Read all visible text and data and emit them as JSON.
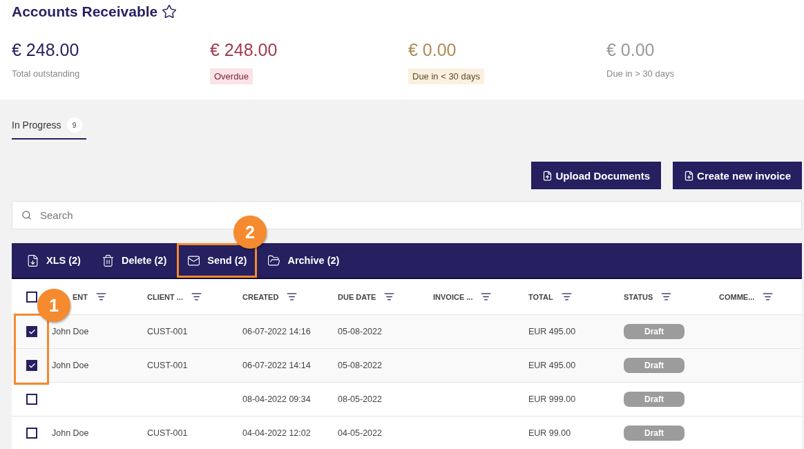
{
  "page": {
    "title": "Accounts Receivable",
    "favorite": false
  },
  "summary": [
    {
      "kind": "total",
      "amount": "€ 248.00",
      "label": "Total outstanding"
    },
    {
      "kind": "overdue",
      "amount": "€ 248.00",
      "label": "Overdue"
    },
    {
      "kind": "soon",
      "amount": "€ 0.00",
      "label": "Due in < 30 days"
    },
    {
      "kind": "later",
      "amount": "€ 0.00",
      "label": "Due in > 30 days"
    }
  ],
  "tabs": [
    {
      "label": "In Progress",
      "count": "9",
      "selected": true
    }
  ],
  "actions": [
    {
      "kind": "upload",
      "label": "Upload Documents"
    },
    {
      "kind": "create",
      "label": "Create new invoice"
    }
  ],
  "search": {
    "placeholder": "Search"
  },
  "toolbar": [
    {
      "kind": "xls",
      "label": "XLS (2)",
      "highlighted": false
    },
    {
      "kind": "delete",
      "label": "Delete (2)",
      "highlighted": false
    },
    {
      "kind": "send",
      "label": "Send (2)",
      "highlighted": true
    },
    {
      "kind": "archive",
      "label": "Archive (2)",
      "highlighted": false
    }
  ],
  "table": {
    "all_checked": false,
    "columns": [
      "ENT",
      "CLIENT ...",
      "CREATED",
      "DUE DATE",
      "INVOICE ...",
      "TOTAL",
      "STATUS",
      "COMME..."
    ],
    "rows": [
      {
        "checked": true,
        "cells": [
          "John Doe",
          "CUST-001",
          "06-07-2022 14:16",
          "05-08-2022",
          "",
          "EUR 495.00"
        ],
        "status": "Draft"
      },
      {
        "checked": true,
        "cells": [
          "John Doe",
          "CUST-001",
          "06-07-2022 14:14",
          "05-08-2022",
          "",
          "EUR 495.00"
        ],
        "status": "Draft"
      },
      {
        "checked": false,
        "cells": [
          "",
          "",
          "08-04-2022 09:34",
          "08-05-2022",
          "",
          "EUR 999.00"
        ],
        "status": "Draft"
      },
      {
        "checked": false,
        "cells": [
          "John Doe",
          "CUST-001",
          "04-04-2022 12:02",
          "04-05-2022",
          "",
          "EUR 99.00"
        ],
        "status": "Draft"
      }
    ]
  },
  "annotations": [
    {
      "number": "1"
    },
    {
      "number": "2"
    }
  ]
}
